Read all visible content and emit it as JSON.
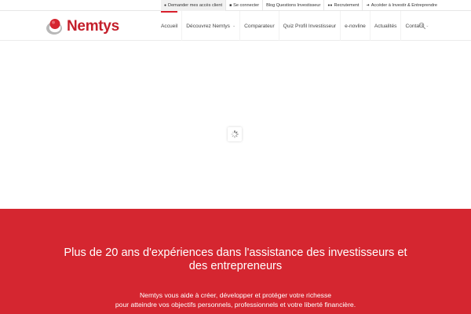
{
  "topbar": {
    "links": [
      {
        "icon": "user-icon",
        "label": "Demander mes accès client"
      },
      {
        "icon": "lock-icon",
        "label": "Se connecter"
      },
      {
        "label": "Blog Questions Investisseur"
      },
      {
        "icon": "people-icon",
        "label": "Recrutement"
      },
      {
        "icon": "sign-in-icon",
        "label": "Accéder à Investir & Entreprendre"
      }
    ]
  },
  "header": {
    "logo_text": "Nemtys",
    "nav": [
      {
        "label": "Accueil",
        "active": true
      },
      {
        "label": "Découvrez Nemtys",
        "dropdown": true
      },
      {
        "label": "Comparateur"
      },
      {
        "label": "Quiz Profil Investisseur"
      },
      {
        "label": "e-novline"
      },
      {
        "label": "Actualités"
      },
      {
        "label": "Contact",
        "dropdown": true
      }
    ],
    "search_icon": "search-icon"
  },
  "loader_icon": "spinner-icon",
  "band": {
    "title": "Plus de 20 ans d'expériences dans l'assistance des investisseurs et des entrepreneurs",
    "text_line1": "Nemtys vous aide à créer, développer et protéger votre richesse",
    "text_line2": "pour atteindre vos objectifs personnels, professionnels et votre liberté financière."
  },
  "colors": {
    "brand_red": "#d52630",
    "logo_red": "#c41f2b",
    "active_nav_bar": "#d8202c"
  }
}
